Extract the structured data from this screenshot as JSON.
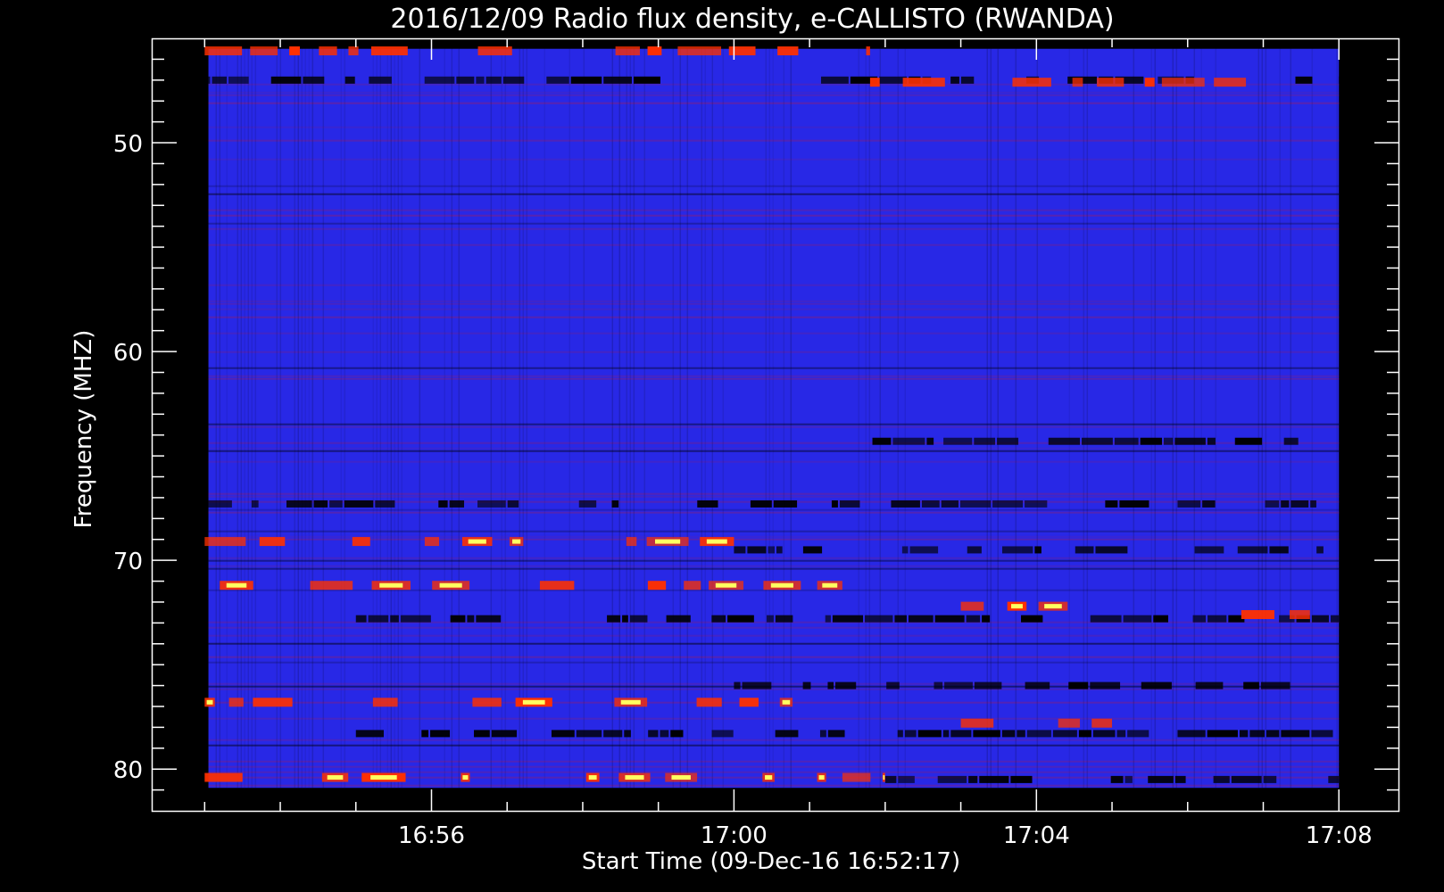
{
  "chart_data": {
    "type": "heatmap",
    "title": "2016/12/09  Radio flux density, e-CALLISTO (RWANDA)",
    "xlabel": "Start Time (09-Dec-16 16:52:17)",
    "ylabel": "Frequency (MHZ)",
    "x_tick_labels": [
      "16:56",
      "17:00",
      "17:04",
      "17:08"
    ],
    "x_ticks_minutes": [
      236,
      240,
      244,
      248
    ],
    "x_range_minutes": [
      232.3,
      248.8
    ],
    "data_x_range_minutes": [
      233.05,
      248.0
    ],
    "y_tick_labels": [
      "50",
      "60",
      "70",
      "80"
    ],
    "y_ticks": [
      50,
      60,
      70,
      80
    ],
    "y_range": [
      45.0,
      82.0
    ],
    "y_reversed": true,
    "data_y_range": [
      45.5,
      80.9
    ],
    "colors": {
      "background": "#000000",
      "base": "#2828e6",
      "low": "#000000",
      "mid": "#8a1e78",
      "high": "#ff3000",
      "peak": "#ffff60"
    },
    "emission_bands": [
      {
        "freq": 45.6,
        "intensity": "high",
        "t_start": 233.0,
        "t_end": 241.8
      },
      {
        "freq": 47.1,
        "intensity": "high",
        "t_start": 241.8,
        "t_end": 247.0
      },
      {
        "freq": 69.1,
        "intensity": "peak",
        "t_start": 233.0,
        "t_end": 240.0
      },
      {
        "freq": 71.2,
        "intensity": "peak",
        "t_start": 233.2,
        "t_end": 241.5
      },
      {
        "freq": 72.2,
        "intensity": "peak",
        "t_start": 243.0,
        "t_end": 245.0
      },
      {
        "freq": 72.6,
        "intensity": "high",
        "t_start": 246.2,
        "t_end": 247.9
      },
      {
        "freq": 76.8,
        "intensity": "peak",
        "t_start": 233.0,
        "t_end": 241.5
      },
      {
        "freq": 77.8,
        "intensity": "peak",
        "t_start": 243.0,
        "t_end": 245.0
      },
      {
        "freq": 80.4,
        "intensity": "peak",
        "t_start": 233.0,
        "t_end": 242.0
      }
    ],
    "dark_bands": [
      {
        "freq": 47.0,
        "t_start": 233.0,
        "t_end": 248.0
      },
      {
        "freq": 64.3,
        "t_start": 241.5,
        "t_end": 248.0
      },
      {
        "freq": 67.3,
        "t_start": 233.0,
        "t_end": 248.0
      },
      {
        "freq": 69.5,
        "t_start": 240.0,
        "t_end": 248.0
      },
      {
        "freq": 72.8,
        "t_start": 235.0,
        "t_end": 248.0
      },
      {
        "freq": 76.0,
        "t_start": 240.0,
        "t_end": 248.0
      },
      {
        "freq": 78.3,
        "t_start": 235.0,
        "t_end": 248.0
      },
      {
        "freq": 80.5,
        "t_start": 242.0,
        "t_end": 248.0
      }
    ]
  }
}
